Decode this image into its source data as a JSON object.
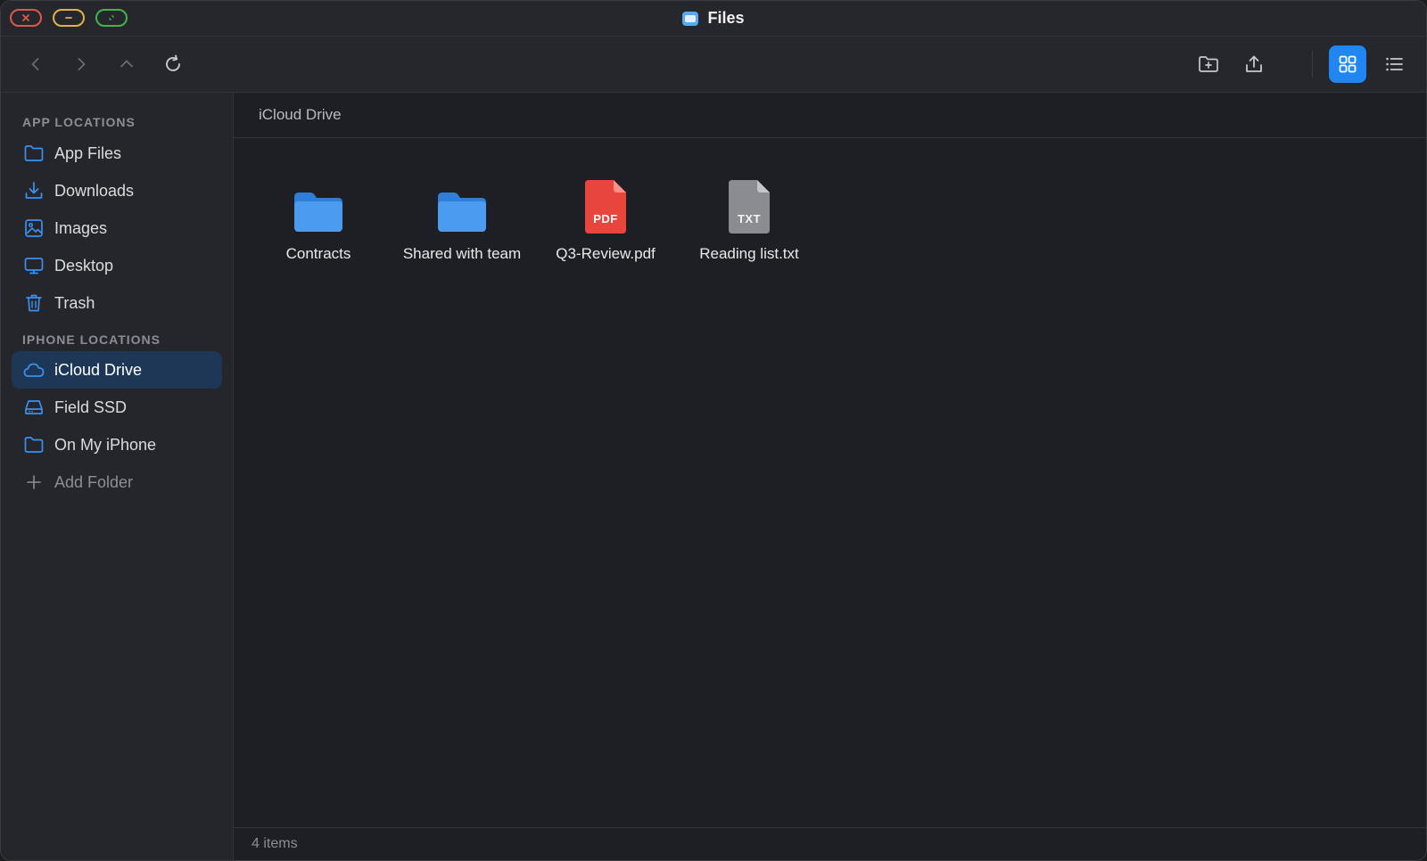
{
  "window": {
    "title": "Files"
  },
  "toolbar": {
    "back_icon": "chevron-left-icon",
    "forward_icon": "chevron-right-icon",
    "up_icon": "chevron-up-icon",
    "refresh_icon": "refresh-icon",
    "new_folder_icon": "folder-plus-icon",
    "share_icon": "upload-icon",
    "grid_view_icon": "grid-view-icon",
    "list_view_icon": "list-view-icon",
    "active_view": "grid",
    "accent_color": "#1f86f2"
  },
  "sidebar": {
    "app_section": "APP LOCATIONS",
    "app_items": [
      {
        "label": "App Files",
        "icon": "folder-icon"
      },
      {
        "label": "Downloads",
        "icon": "download-icon"
      },
      {
        "label": "Images",
        "icon": "image-icon"
      },
      {
        "label": "Desktop",
        "icon": "monitor-icon"
      },
      {
        "label": "Trash",
        "icon": "trash-icon"
      }
    ],
    "iphone_section": "IPHONE LOCATIONS",
    "iphone_items": [
      {
        "label": "iCloud Drive",
        "icon": "cloud-icon",
        "selected": true
      },
      {
        "label": "Field SSD",
        "icon": "drive-icon"
      },
      {
        "label": "On My iPhone",
        "icon": "folder-icon"
      }
    ],
    "add_folder": {
      "label": "Add Folder",
      "icon": "plus-icon"
    },
    "selected_color": "#1f3756"
  },
  "main": {
    "path": "iCloud Drive",
    "items": [
      {
        "name": "Contracts",
        "type": "folder"
      },
      {
        "name": "Shared with team",
        "type": "folder"
      },
      {
        "name": "Q3-Review.pdf",
        "type": "pdf",
        "badge": "PDF"
      },
      {
        "name": "Reading list.txt",
        "type": "txt",
        "badge": "TXT"
      }
    ],
    "status": "4 items"
  }
}
